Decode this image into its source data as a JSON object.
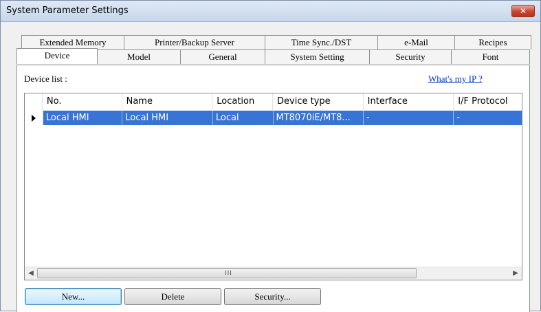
{
  "window": {
    "title": "System Parameter Settings",
    "close_glyph": "✕"
  },
  "tabs_row1": [
    "Extended Memory",
    "Printer/Backup Server",
    "Time Sync./DST",
    "e-Mail",
    "Recipes"
  ],
  "tabs_row2": [
    "Device",
    "Model",
    "General",
    "System Setting",
    "Security",
    "Font"
  ],
  "active_tab": "Device",
  "device_panel": {
    "label": "Device list :",
    "link": "What's my IP ?",
    "columns": [
      "No.",
      "Name",
      "Location",
      "Device type",
      "Interface",
      "I/F Protocol"
    ],
    "rows": [
      {
        "no": "Local HMI",
        "name": "Local HMI",
        "location": "Local",
        "device_type": "MT8070iE/MT8...",
        "interface": "-",
        "protocol": "-"
      }
    ],
    "selected_row": 0
  },
  "scrollbar": {
    "left_glyph": "◀",
    "right_glyph": "▶",
    "grip": "III"
  },
  "buttons": {
    "new": "New...",
    "delete": "Delete",
    "security": "Security..."
  },
  "colors": {
    "selection": "#3874d6",
    "link": "#0033cc"
  }
}
